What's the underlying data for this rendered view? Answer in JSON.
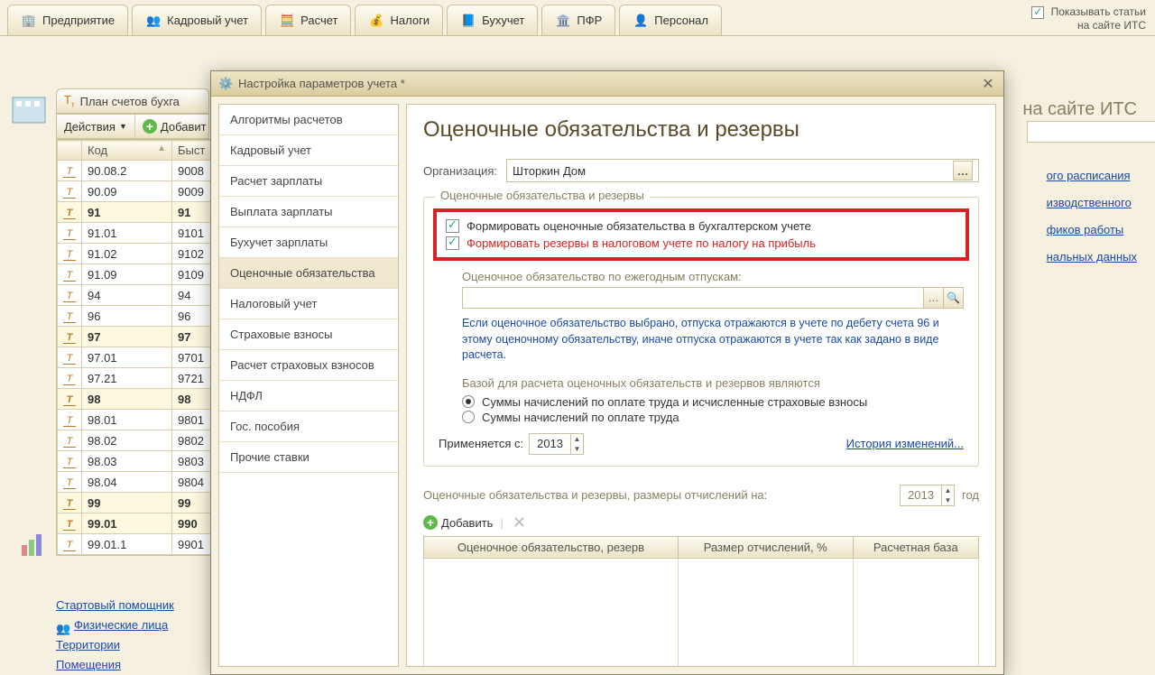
{
  "top_tabs": {
    "t0": "Предприятие",
    "t1": "Кадровый учет",
    "t2": "Расчет",
    "t3": "Налоги",
    "t4": "Бухучет",
    "t5": "ПФР",
    "t6": "Персонал"
  },
  "right_panel": {
    "line1": "Показывать статьи",
    "line2": "на сайте ИТС"
  },
  "its_header": "на сайте ИТС",
  "plan_tab": "План счетов бухга",
  "toolbar": {
    "actions": "Действия",
    "add": "Добавит"
  },
  "table": {
    "h0": "",
    "h1": "Код",
    "h2": "Быст",
    "rows": [
      {
        "b": false,
        "c1": "90.08.2",
        "c2": "9008"
      },
      {
        "b": false,
        "c1": "90.09",
        "c2": "9009"
      },
      {
        "b": true,
        "c1": "91",
        "c2": "91"
      },
      {
        "b": false,
        "c1": "91.01",
        "c2": "9101"
      },
      {
        "b": false,
        "c1": "91.02",
        "c2": "9102"
      },
      {
        "b": false,
        "c1": "91.09",
        "c2": "9109"
      },
      {
        "b": false,
        "c1": "94",
        "c2": "94"
      },
      {
        "b": false,
        "c1": "96",
        "c2": "96"
      },
      {
        "b": true,
        "c1": "97",
        "c2": "97"
      },
      {
        "b": false,
        "c1": "97.01",
        "c2": "9701"
      },
      {
        "b": false,
        "c1": "97.21",
        "c2": "9721"
      },
      {
        "b": true,
        "c1": "98",
        "c2": "98"
      },
      {
        "b": false,
        "c1": "98.01",
        "c2": "9801"
      },
      {
        "b": false,
        "c1": "98.02",
        "c2": "9802"
      },
      {
        "b": false,
        "c1": "98.03",
        "c2": "9803"
      },
      {
        "b": false,
        "c1": "98.04",
        "c2": "9804"
      },
      {
        "b": true,
        "c1": "99",
        "c2": "99"
      },
      {
        "b": true,
        "c1": "99.01",
        "c2": "990"
      },
      {
        "b": false,
        "c1": "99.01.1",
        "c2": "9901"
      }
    ]
  },
  "bottom_links": {
    "l1": "Стартовый помощник",
    "l2": "Физические лица",
    "l3": "Территории",
    "l4": "Помещения"
  },
  "side_links": {
    "l1": "ого расписания",
    "l2": "изводственного",
    "l3": "фиков работы",
    "l4": "нальных данных"
  },
  "dialog": {
    "title": "Настройка параметров учета *",
    "nav": [
      "Алгоритмы расчетов",
      "Кадровый учет",
      "Расчет зарплаты",
      "Выплата зарплаты",
      "Бухучет зарплаты",
      "Оценочные обязательства",
      "Налоговый учет",
      "Страховые взносы",
      "Расчет страховых взносов",
      "НДФЛ",
      "Гос. пособия",
      "Прочие ставки"
    ],
    "active_idx": 5,
    "heading": "Оценочные обязательства и резервы",
    "org_label": "Организация:",
    "org_value": "Шторкин Дом",
    "group_title": "Оценочные обязательства и резервы",
    "chk1": "Формировать оценочные обязательства в бухгалтерском учете",
    "chk2": "Формировать резервы в налоговом учете по налогу на прибыль",
    "sub_label": "Оценочное обязательство по ежегодным отпускам:",
    "info": "Если оценочное обязательство выбрано, отпуска отражаются в учете по дебету счета 96 и этому оценочному обязательству, иначе отпуска отражаются в учете так как задано в виде расчета.",
    "base_head": "Базой для расчета оценочных обязательств и резервов являются",
    "radio1": "Суммы начислений по оплате труда и исчисленные страховые взносы",
    "radio2": "Суммы начислений по оплате труда",
    "apply_label": "Применяется с:",
    "apply_year": "2013",
    "history": "История изменений...",
    "alloc_label": "Оценочные обязательства и резервы, размеры отчислений на:",
    "alloc_year": "2013",
    "alloc_year_suffix": "год",
    "add_label": "Добавить",
    "cols": {
      "c1": "Оценочное обязательство, резерв",
      "c2": "Размер отчислений, %",
      "c3": "Расчетная база"
    }
  }
}
